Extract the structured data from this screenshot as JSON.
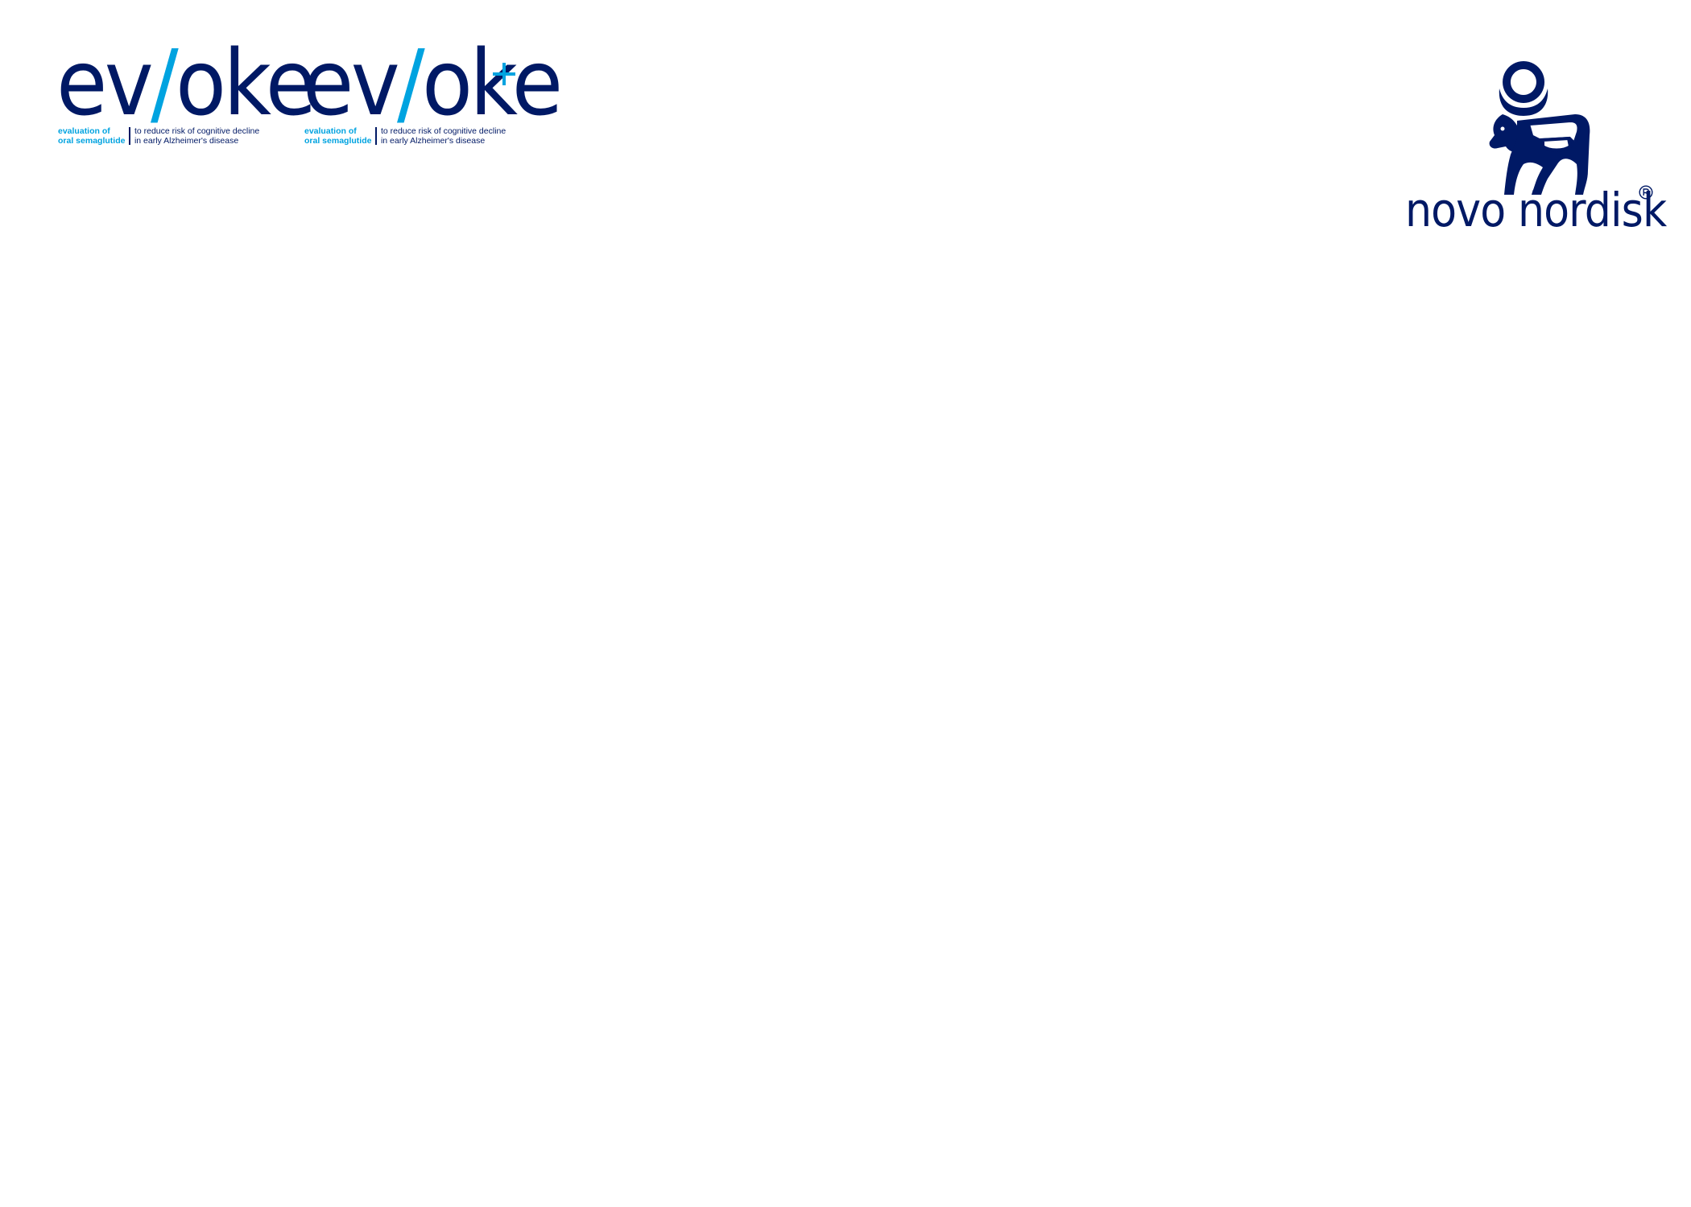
{
  "logos": {
    "evoke": {
      "wordmark_start": "ev",
      "wordmark_slash": "/",
      "wordmark_end": "oke",
      "tagline_left_line1": "evaluation of",
      "tagline_left_line2": "oral semaglutide",
      "tagline_right_line1": "to reduce risk of cognitive decline",
      "tagline_right_line2": "in early Alzheimer's disease"
    },
    "evoke_plus": {
      "wordmark_start": "ev",
      "wordmark_slash": "/",
      "wordmark_end": "oke",
      "plus_icon": "plus-icon",
      "tagline_left_line1": "evaluation of",
      "tagline_left_line2": "oral semaglutide",
      "tagline_right_line1": "to reduce risk of cognitive decline",
      "tagline_right_line2": "in early Alzheimer's disease"
    },
    "novo_nordisk": {
      "wordmark": "novo nordisk",
      "symbol_icon": "apis-bull-icon",
      "registered_icon": "registered-trademark-icon"
    }
  },
  "colors": {
    "navy": "#001965",
    "sky_blue": "#00a3e0",
    "background": "#ffffff"
  }
}
